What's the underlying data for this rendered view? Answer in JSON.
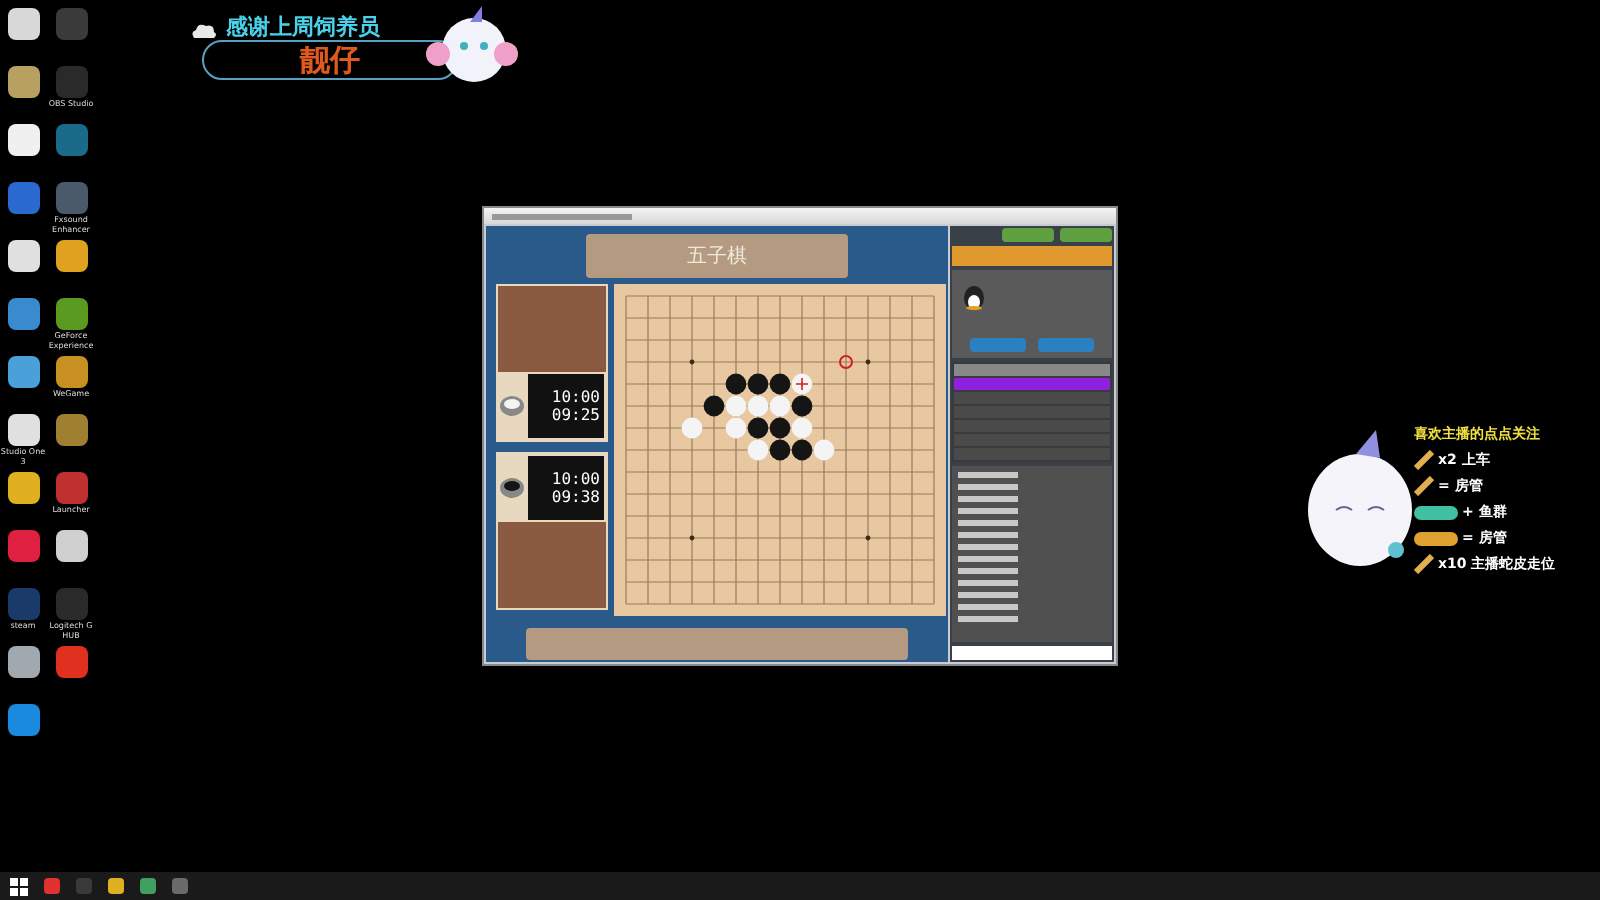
{
  "desktop_icons": [
    {
      "color": "#d8d8d8"
    },
    {
      "color": "#3a3a3a"
    },
    {
      "color": "#b8a060"
    },
    {
      "color": "#2a2a2a",
      "label": "OBS Studio"
    },
    {
      "color": "#f0f0f0"
    },
    {
      "color": "#1a6a8a"
    },
    {
      "color": "#2a6ad0"
    },
    {
      "color": "#4a5a6a",
      "label": "Fxsound Enhancer"
    },
    {
      "color": "#e0e0e0"
    },
    {
      "color": "#e0a020"
    },
    {
      "color": "#3a8ad0"
    },
    {
      "color": "#5a9a20",
      "label": "GeForce Experience"
    },
    {
      "color": "#4aa0d8"
    },
    {
      "color": "#c89020",
      "label": "WeGame"
    },
    {
      "color": "#e0e0e0",
      "label": "Studio One 3"
    },
    {
      "color": "#a08030"
    },
    {
      "color": "#e0b020"
    },
    {
      "color": "#c03030",
      "label": "Launcher"
    },
    {
      "color": "#e02040"
    },
    {
      "color": "#d0d0d0"
    },
    {
      "color": "#1a3a6a",
      "label": "steam"
    },
    {
      "color": "#2a2a2a",
      "label": "Logitech G HUB"
    },
    {
      "color": "#a0a8b0"
    },
    {
      "color": "#e03020"
    },
    {
      "color": "#1a8ae0"
    }
  ],
  "banner": {
    "heading": "感谢上周饲养员",
    "name": "靓仔"
  },
  "game": {
    "title": "五子棋",
    "players": [
      {
        "time_total": "10:00",
        "time_left": "09:25",
        "kind": "white"
      },
      {
        "time_total": "10:00",
        "time_left": "09:38",
        "kind": "black"
      }
    ],
    "board": [
      [
        {
          "kind": "empty"
        },
        {
          "kind": "empty"
        },
        {
          "kind": "empty"
        },
        {
          "kind": "empty"
        },
        {
          "kind": "empty"
        },
        {
          "kind": "empty"
        },
        {
          "kind": "empty"
        },
        {
          "kind": "empty"
        },
        {
          "kind": "empty"
        },
        {
          "kind": "empty"
        },
        {
          "kind": "empty"
        },
        {
          "kind": "empty"
        },
        {
          "kind": "empty"
        },
        {
          "kind": "empty"
        },
        {
          "kind": "empty"
        }
      ],
      [
        {
          "kind": "empty"
        },
        {
          "kind": "empty"
        },
        {
          "kind": "empty"
        },
        {
          "kind": "empty"
        },
        {
          "kind": "empty"
        },
        {
          "kind": "empty"
        },
        {
          "kind": "empty"
        },
        {
          "kind": "empty"
        },
        {
          "kind": "empty"
        },
        {
          "kind": "empty"
        },
        {
          "kind": "empty"
        },
        {
          "kind": "empty"
        },
        {
          "kind": "empty"
        },
        {
          "kind": "empty"
        },
        {
          "kind": "empty"
        }
      ],
      [
        {
          "kind": "empty"
        },
        {
          "kind": "empty"
        },
        {
          "kind": "empty"
        },
        {
          "kind": "empty"
        },
        {
          "kind": "empty"
        },
        {
          "kind": "empty"
        },
        {
          "kind": "empty"
        },
        {
          "kind": "empty"
        },
        {
          "kind": "empty"
        },
        {
          "kind": "empty"
        },
        {
          "kind": "empty"
        },
        {
          "kind": "empty"
        },
        {
          "kind": "empty"
        },
        {
          "kind": "empty"
        },
        {
          "kind": "empty"
        }
      ],
      [
        {
          "kind": "empty"
        },
        {
          "kind": "empty"
        },
        {
          "kind": "empty"
        },
        {
          "kind": "empty"
        },
        {
          "kind": "empty"
        },
        {
          "kind": "empty"
        },
        {
          "kind": "empty"
        },
        {
          "kind": "empty"
        },
        {
          "kind": "empty"
        },
        {
          "kind": "empty"
        },
        {
          "kind": "marker"
        },
        {
          "kind": "empty"
        },
        {
          "kind": "empty"
        },
        {
          "kind": "empty"
        },
        {
          "kind": "empty"
        }
      ],
      [
        {
          "kind": "empty"
        },
        {
          "kind": "empty"
        },
        {
          "kind": "empty"
        },
        {
          "kind": "empty"
        },
        {
          "kind": "empty"
        },
        {
          "kind": "black"
        },
        {
          "kind": "black"
        },
        {
          "kind": "black"
        },
        {
          "kind": "last"
        },
        {
          "kind": "empty"
        },
        {
          "kind": "empty"
        },
        {
          "kind": "empty"
        },
        {
          "kind": "empty"
        },
        {
          "kind": "empty"
        },
        {
          "kind": "empty"
        }
      ],
      [
        {
          "kind": "empty"
        },
        {
          "kind": "empty"
        },
        {
          "kind": "empty"
        },
        {
          "kind": "empty"
        },
        {
          "kind": "black"
        },
        {
          "kind": "white"
        },
        {
          "kind": "white"
        },
        {
          "kind": "white"
        },
        {
          "kind": "black"
        },
        {
          "kind": "empty"
        },
        {
          "kind": "empty"
        },
        {
          "kind": "empty"
        },
        {
          "kind": "empty"
        },
        {
          "kind": "empty"
        },
        {
          "kind": "empty"
        }
      ],
      [
        {
          "kind": "empty"
        },
        {
          "kind": "empty"
        },
        {
          "kind": "empty"
        },
        {
          "kind": "white"
        },
        {
          "kind": "empty"
        },
        {
          "kind": "white"
        },
        {
          "kind": "black"
        },
        {
          "kind": "black"
        },
        {
          "kind": "white"
        },
        {
          "kind": "empty"
        },
        {
          "kind": "empty"
        },
        {
          "kind": "empty"
        },
        {
          "kind": "empty"
        },
        {
          "kind": "empty"
        },
        {
          "kind": "empty"
        }
      ],
      [
        {
          "kind": "empty"
        },
        {
          "kind": "empty"
        },
        {
          "kind": "empty"
        },
        {
          "kind": "empty"
        },
        {
          "kind": "empty"
        },
        {
          "kind": "empty"
        },
        {
          "kind": "white"
        },
        {
          "kind": "black"
        },
        {
          "kind": "black"
        },
        {
          "kind": "white"
        },
        {
          "kind": "empty"
        },
        {
          "kind": "empty"
        },
        {
          "kind": "empty"
        },
        {
          "kind": "empty"
        },
        {
          "kind": "empty"
        }
      ],
      [
        {
          "kind": "empty"
        },
        {
          "kind": "empty"
        },
        {
          "kind": "empty"
        },
        {
          "kind": "empty"
        },
        {
          "kind": "empty"
        },
        {
          "kind": "empty"
        },
        {
          "kind": "empty"
        },
        {
          "kind": "empty"
        },
        {
          "kind": "empty"
        },
        {
          "kind": "empty"
        },
        {
          "kind": "empty"
        },
        {
          "kind": "empty"
        },
        {
          "kind": "empty"
        },
        {
          "kind": "empty"
        },
        {
          "kind": "empty"
        }
      ],
      [
        {
          "kind": "empty"
        },
        {
          "kind": "empty"
        },
        {
          "kind": "empty"
        },
        {
          "kind": "empty"
        },
        {
          "kind": "empty"
        },
        {
          "kind": "empty"
        },
        {
          "kind": "empty"
        },
        {
          "kind": "empty"
        },
        {
          "kind": "empty"
        },
        {
          "kind": "empty"
        },
        {
          "kind": "empty"
        },
        {
          "kind": "empty"
        },
        {
          "kind": "empty"
        },
        {
          "kind": "empty"
        },
        {
          "kind": "empty"
        }
      ],
      [
        {
          "kind": "empty"
        },
        {
          "kind": "empty"
        },
        {
          "kind": "empty"
        },
        {
          "kind": "empty"
        },
        {
          "kind": "empty"
        },
        {
          "kind": "empty"
        },
        {
          "kind": "empty"
        },
        {
          "kind": "empty"
        },
        {
          "kind": "empty"
        },
        {
          "kind": "empty"
        },
        {
          "kind": "empty"
        },
        {
          "kind": "empty"
        },
        {
          "kind": "empty"
        },
        {
          "kind": "empty"
        },
        {
          "kind": "empty"
        }
      ],
      [
        {
          "kind": "empty"
        },
        {
          "kind": "empty"
        },
        {
          "kind": "empty"
        },
        {
          "kind": "empty"
        },
        {
          "kind": "empty"
        },
        {
          "kind": "empty"
        },
        {
          "kind": "empty"
        },
        {
          "kind": "empty"
        },
        {
          "kind": "empty"
        },
        {
          "kind": "empty"
        },
        {
          "kind": "empty"
        },
        {
          "kind": "empty"
        },
        {
          "kind": "empty"
        },
        {
          "kind": "empty"
        },
        {
          "kind": "empty"
        }
      ],
      [
        {
          "kind": "empty"
        },
        {
          "kind": "empty"
        },
        {
          "kind": "empty"
        },
        {
          "kind": "empty"
        },
        {
          "kind": "empty"
        },
        {
          "kind": "empty"
        },
        {
          "kind": "empty"
        },
        {
          "kind": "empty"
        },
        {
          "kind": "empty"
        },
        {
          "kind": "empty"
        },
        {
          "kind": "empty"
        },
        {
          "kind": "empty"
        },
        {
          "kind": "empty"
        },
        {
          "kind": "empty"
        },
        {
          "kind": "empty"
        }
      ],
      [
        {
          "kind": "empty"
        },
        {
          "kind": "empty"
        },
        {
          "kind": "empty"
        },
        {
          "kind": "empty"
        },
        {
          "kind": "empty"
        },
        {
          "kind": "empty"
        },
        {
          "kind": "empty"
        },
        {
          "kind": "empty"
        },
        {
          "kind": "empty"
        },
        {
          "kind": "empty"
        },
        {
          "kind": "empty"
        },
        {
          "kind": "empty"
        },
        {
          "kind": "empty"
        },
        {
          "kind": "empty"
        },
        {
          "kind": "empty"
        }
      ],
      [
        {
          "kind": "empty"
        },
        {
          "kind": "empty"
        },
        {
          "kind": "empty"
        },
        {
          "kind": "empty"
        },
        {
          "kind": "empty"
        },
        {
          "kind": "empty"
        },
        {
          "kind": "empty"
        },
        {
          "kind": "empty"
        },
        {
          "kind": "empty"
        },
        {
          "kind": "empty"
        },
        {
          "kind": "empty"
        },
        {
          "kind": "empty"
        },
        {
          "kind": "empty"
        },
        {
          "kind": "empty"
        },
        {
          "kind": "empty"
        }
      ]
    ],
    "player_list": [
      {
        "selected": true
      },
      {
        "selected": false
      },
      {
        "selected": false
      },
      {
        "selected": false
      },
      {
        "selected": false
      },
      {
        "selected": false
      }
    ]
  },
  "overlay": {
    "heading": "喜欢主播的点点关注",
    "rewards": [
      {
        "kind": "gift",
        "text": "x2 上车"
      },
      {
        "kind": "gift",
        "text": "= 房管"
      },
      {
        "kind": "pill",
        "color": "#40c0a0",
        "text": "+ 鱼群"
      },
      {
        "kind": "pill",
        "color": "#e0a030",
        "text": "= 房管"
      },
      {
        "kind": "gift",
        "text": "x10 主播蛇皮走位"
      }
    ]
  }
}
